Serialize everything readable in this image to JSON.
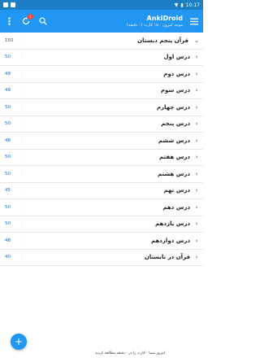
{
  "statusbar": {
    "time": "10:17"
  },
  "appbar": {
    "title": "AnkiDroid",
    "subtitle": "موعد امروز: ۱۵۰ کارت (۰ دقیقه)",
    "sync_badge": "1"
  },
  "decks": [
    {
      "name": "قرآن پنجم دبستان",
      "count": "150",
      "expand": "⌄"
    },
    {
      "name": "درس اول",
      "count": "50",
      "expand": "›"
    },
    {
      "name": "درس دوم",
      "count": "49",
      "expand": "›"
    },
    {
      "name": "درس سوم",
      "count": "49",
      "expand": "›"
    },
    {
      "name": "درس چهارم",
      "count": "50",
      "expand": "›"
    },
    {
      "name": "درس پنجم",
      "count": "50",
      "expand": "›"
    },
    {
      "name": "درس ششم",
      "count": "48",
      "expand": "›"
    },
    {
      "name": "درس هفتم",
      "count": "50",
      "expand": "›"
    },
    {
      "name": "درس هشتم",
      "count": "50",
      "expand": "›"
    },
    {
      "name": "درس نهم",
      "count": "45",
      "expand": "›"
    },
    {
      "name": "درس دهم",
      "count": "50",
      "expand": "›"
    },
    {
      "name": "درس یازدهم",
      "count": "50",
      "expand": "›"
    },
    {
      "name": "درس دوازدهم",
      "count": "48",
      "expand": "›"
    },
    {
      "name": "قرآن در تابستان",
      "count": "40",
      "expand": "›"
    }
  ],
  "fab": {
    "label": "+"
  },
  "footer": {
    "text": "امروز شما - کارت را در - دقیقه مطالعه کردید"
  },
  "colors": {
    "primary": "#2196f3",
    "statusbar": "#1a7fc4",
    "count": "#1565c0"
  }
}
